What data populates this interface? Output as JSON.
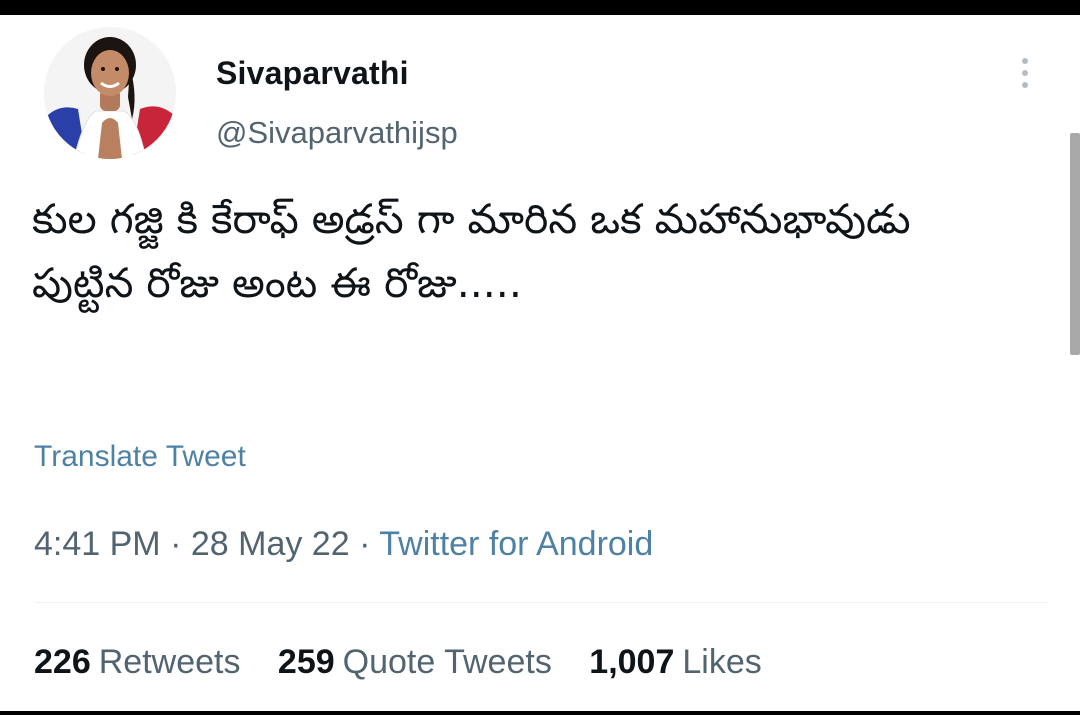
{
  "tweet": {
    "author": {
      "display_name": "Sivaparvathi",
      "handle": "@Sivaparvathijsp",
      "avatar_icon": "profile-photo"
    },
    "more_icon": "more-vertical-icon",
    "text": "కుల గజ్జి కి కేరాఫ్ అడ్రస్ గా మారిన ఒక మహానుభావుడు పుట్టిన రోజు అంట ఈ రోజు.....",
    "translate_label": "Translate Tweet",
    "time": "4:41 PM",
    "separator": "·",
    "date": "28 May 22",
    "source": "Twitter for Android",
    "stats": {
      "retweets": {
        "count": "226",
        "label": "Retweets"
      },
      "quote_tweets": {
        "count": "259",
        "label": "Quote Tweets"
      },
      "likes": {
        "count": "1,007",
        "label": "Likes"
      }
    }
  },
  "colors": {
    "text_primary": "#0f1419",
    "text_secondary": "#536471",
    "link": "#1d9bf0",
    "divider": "#eff3f4"
  }
}
